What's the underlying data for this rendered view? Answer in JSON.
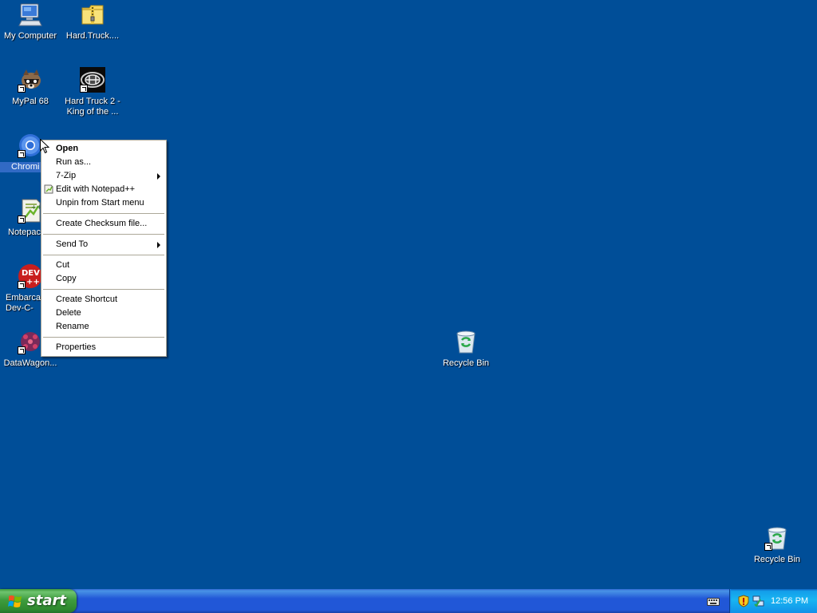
{
  "desktop": {
    "background_color": "#004e98",
    "icons": [
      {
        "label": "My Computer",
        "icon": "my-computer-icon"
      },
      {
        "label": "Hard.Truck....",
        "icon": "zip-folder-icon"
      },
      {
        "label": "MyPal 68",
        "icon": "mypal-raccoon-icon"
      },
      {
        "label": "Hard Truck 2 -\nKing of the ...",
        "icon": "hard-truck-game-icon"
      },
      {
        "label": "Chromi",
        "icon": "chromium-icon"
      },
      {
        "label": "Notepac",
        "icon": "notepad-plus-plus-icon"
      },
      {
        "label": "Embarca\nDev-C-",
        "icon": "dev-cpp-icon"
      },
      {
        "label": "DataWagon...",
        "icon": "datawagon-icon"
      },
      {
        "label": "Recycle Bin",
        "icon": "recycle-bin-icon"
      },
      {
        "label": "Recycle Bin",
        "icon": "recycle-bin-icon"
      }
    ]
  },
  "context_menu": {
    "items": [
      {
        "label": "Open"
      },
      {
        "label": "Run as..."
      },
      {
        "label": "7-Zip"
      },
      {
        "label": "Edit with Notepad++"
      },
      {
        "label": "Unpin from Start menu"
      },
      {
        "label": "Create Checksum file..."
      },
      {
        "label": "Send To"
      },
      {
        "label": "Cut"
      },
      {
        "label": "Copy"
      },
      {
        "label": "Create Shortcut"
      },
      {
        "label": "Delete"
      },
      {
        "label": "Rename"
      },
      {
        "label": "Properties"
      }
    ]
  },
  "taskbar": {
    "start_label": "start",
    "clock": "12:56 PM",
    "tray_icons": [
      "keyboard-icon",
      "security-shield-icon",
      "network-icon"
    ]
  },
  "colors": {
    "desktop": "#004e98",
    "taskbar": "#2157d7",
    "start_button": "#3e9c3e",
    "tray": "#18b5f2",
    "menu_border": "#aca899"
  }
}
